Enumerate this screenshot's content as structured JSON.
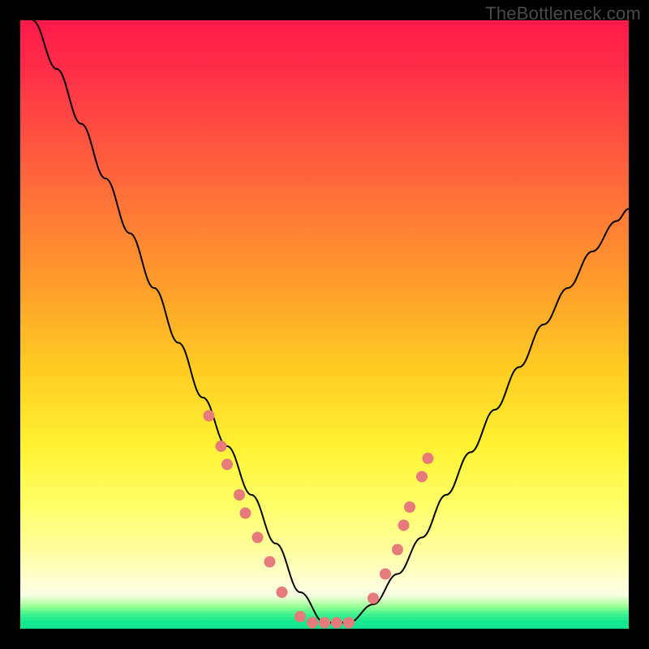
{
  "watermark": "TheBottleneck.com",
  "colors": {
    "gradient_top": "#ff1a4a",
    "gradient_mid": "#ffe23a",
    "gradient_bottom": "#0fe28c",
    "curve": "#000000",
    "marker": "#e77a7a",
    "frame": "#000000"
  },
  "chart_data": {
    "type": "line",
    "title": "",
    "xlabel": "",
    "ylabel": "",
    "xlim": [
      0,
      100
    ],
    "ylim": [
      0,
      100
    ],
    "grid": false,
    "legend": false,
    "note": "Axes are unlabeled in the image; x scaled 0–100 left→right, y scaled 0–100 bottom→top (0 at green floor). Curve is a V-shape with minimum near x≈50, y≈1.",
    "series": [
      {
        "name": "bottleneck-curve",
        "x": [
          2,
          6,
          10,
          14,
          18,
          22,
          26,
          30,
          34,
          38,
          42,
          46,
          50,
          54,
          58,
          62,
          66,
          70,
          74,
          78,
          82,
          86,
          90,
          94,
          98,
          100
        ],
        "y": [
          100,
          92,
          83,
          74,
          65,
          56,
          47,
          38,
          30,
          22,
          14,
          6,
          1,
          1,
          4,
          9,
          15,
          22,
          29,
          36,
          43,
          50,
          56,
          62,
          67,
          69
        ]
      }
    ],
    "markers": {
      "name": "highlighted-points",
      "note": "Salmon dot clusters on both flanks of the V and along its floor",
      "points": [
        {
          "x": 31,
          "y": 35
        },
        {
          "x": 33,
          "y": 30
        },
        {
          "x": 34,
          "y": 27
        },
        {
          "x": 36,
          "y": 22
        },
        {
          "x": 37,
          "y": 19
        },
        {
          "x": 39,
          "y": 15
        },
        {
          "x": 41,
          "y": 11
        },
        {
          "x": 43,
          "y": 6
        },
        {
          "x": 46,
          "y": 2
        },
        {
          "x": 48,
          "y": 1
        },
        {
          "x": 50,
          "y": 1
        },
        {
          "x": 52,
          "y": 1
        },
        {
          "x": 54,
          "y": 1
        },
        {
          "x": 58,
          "y": 5
        },
        {
          "x": 60,
          "y": 9
        },
        {
          "x": 62,
          "y": 13
        },
        {
          "x": 63,
          "y": 17
        },
        {
          "x": 64,
          "y": 20
        },
        {
          "x": 66,
          "y": 25
        },
        {
          "x": 67,
          "y": 28
        }
      ]
    }
  }
}
